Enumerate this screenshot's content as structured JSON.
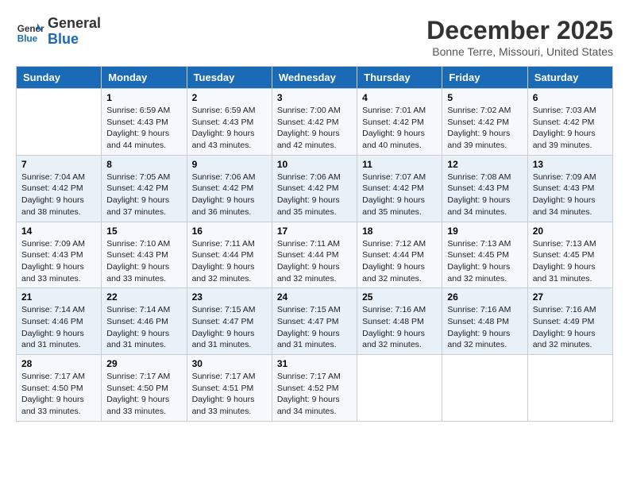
{
  "header": {
    "logo_line1": "General",
    "logo_line2": "Blue",
    "month_title": "December 2025",
    "location": "Bonne Terre, Missouri, United States"
  },
  "weekdays": [
    "Sunday",
    "Monday",
    "Tuesday",
    "Wednesday",
    "Thursday",
    "Friday",
    "Saturday"
  ],
  "weeks": [
    [
      {
        "day": "",
        "info": ""
      },
      {
        "day": "1",
        "info": "Sunrise: 6:59 AM\nSunset: 4:43 PM\nDaylight: 9 hours\nand 44 minutes."
      },
      {
        "day": "2",
        "info": "Sunrise: 6:59 AM\nSunset: 4:43 PM\nDaylight: 9 hours\nand 43 minutes."
      },
      {
        "day": "3",
        "info": "Sunrise: 7:00 AM\nSunset: 4:42 PM\nDaylight: 9 hours\nand 42 minutes."
      },
      {
        "day": "4",
        "info": "Sunrise: 7:01 AM\nSunset: 4:42 PM\nDaylight: 9 hours\nand 40 minutes."
      },
      {
        "day": "5",
        "info": "Sunrise: 7:02 AM\nSunset: 4:42 PM\nDaylight: 9 hours\nand 39 minutes."
      },
      {
        "day": "6",
        "info": "Sunrise: 7:03 AM\nSunset: 4:42 PM\nDaylight: 9 hours\nand 39 minutes."
      }
    ],
    [
      {
        "day": "7",
        "info": "Sunrise: 7:04 AM\nSunset: 4:42 PM\nDaylight: 9 hours\nand 38 minutes."
      },
      {
        "day": "8",
        "info": "Sunrise: 7:05 AM\nSunset: 4:42 PM\nDaylight: 9 hours\nand 37 minutes."
      },
      {
        "day": "9",
        "info": "Sunrise: 7:06 AM\nSunset: 4:42 PM\nDaylight: 9 hours\nand 36 minutes."
      },
      {
        "day": "10",
        "info": "Sunrise: 7:06 AM\nSunset: 4:42 PM\nDaylight: 9 hours\nand 35 minutes."
      },
      {
        "day": "11",
        "info": "Sunrise: 7:07 AM\nSunset: 4:42 PM\nDaylight: 9 hours\nand 35 minutes."
      },
      {
        "day": "12",
        "info": "Sunrise: 7:08 AM\nSunset: 4:43 PM\nDaylight: 9 hours\nand 34 minutes."
      },
      {
        "day": "13",
        "info": "Sunrise: 7:09 AM\nSunset: 4:43 PM\nDaylight: 9 hours\nand 34 minutes."
      }
    ],
    [
      {
        "day": "14",
        "info": "Sunrise: 7:09 AM\nSunset: 4:43 PM\nDaylight: 9 hours\nand 33 minutes."
      },
      {
        "day": "15",
        "info": "Sunrise: 7:10 AM\nSunset: 4:43 PM\nDaylight: 9 hours\nand 33 minutes."
      },
      {
        "day": "16",
        "info": "Sunrise: 7:11 AM\nSunset: 4:44 PM\nDaylight: 9 hours\nand 32 minutes."
      },
      {
        "day": "17",
        "info": "Sunrise: 7:11 AM\nSunset: 4:44 PM\nDaylight: 9 hours\nand 32 minutes."
      },
      {
        "day": "18",
        "info": "Sunrise: 7:12 AM\nSunset: 4:44 PM\nDaylight: 9 hours\nand 32 minutes."
      },
      {
        "day": "19",
        "info": "Sunrise: 7:13 AM\nSunset: 4:45 PM\nDaylight: 9 hours\nand 32 minutes."
      },
      {
        "day": "20",
        "info": "Sunrise: 7:13 AM\nSunset: 4:45 PM\nDaylight: 9 hours\nand 31 minutes."
      }
    ],
    [
      {
        "day": "21",
        "info": "Sunrise: 7:14 AM\nSunset: 4:46 PM\nDaylight: 9 hours\nand 31 minutes."
      },
      {
        "day": "22",
        "info": "Sunrise: 7:14 AM\nSunset: 4:46 PM\nDaylight: 9 hours\nand 31 minutes."
      },
      {
        "day": "23",
        "info": "Sunrise: 7:15 AM\nSunset: 4:47 PM\nDaylight: 9 hours\nand 31 minutes."
      },
      {
        "day": "24",
        "info": "Sunrise: 7:15 AM\nSunset: 4:47 PM\nDaylight: 9 hours\nand 31 minutes."
      },
      {
        "day": "25",
        "info": "Sunrise: 7:16 AM\nSunset: 4:48 PM\nDaylight: 9 hours\nand 32 minutes."
      },
      {
        "day": "26",
        "info": "Sunrise: 7:16 AM\nSunset: 4:48 PM\nDaylight: 9 hours\nand 32 minutes."
      },
      {
        "day": "27",
        "info": "Sunrise: 7:16 AM\nSunset: 4:49 PM\nDaylight: 9 hours\nand 32 minutes."
      }
    ],
    [
      {
        "day": "28",
        "info": "Sunrise: 7:17 AM\nSunset: 4:50 PM\nDaylight: 9 hours\nand 33 minutes."
      },
      {
        "day": "29",
        "info": "Sunrise: 7:17 AM\nSunset: 4:50 PM\nDaylight: 9 hours\nand 33 minutes."
      },
      {
        "day": "30",
        "info": "Sunrise: 7:17 AM\nSunset: 4:51 PM\nDaylight: 9 hours\nand 33 minutes."
      },
      {
        "day": "31",
        "info": "Sunrise: 7:17 AM\nSunset: 4:52 PM\nDaylight: 9 hours\nand 34 minutes."
      },
      {
        "day": "",
        "info": ""
      },
      {
        "day": "",
        "info": ""
      },
      {
        "day": "",
        "info": ""
      }
    ]
  ]
}
